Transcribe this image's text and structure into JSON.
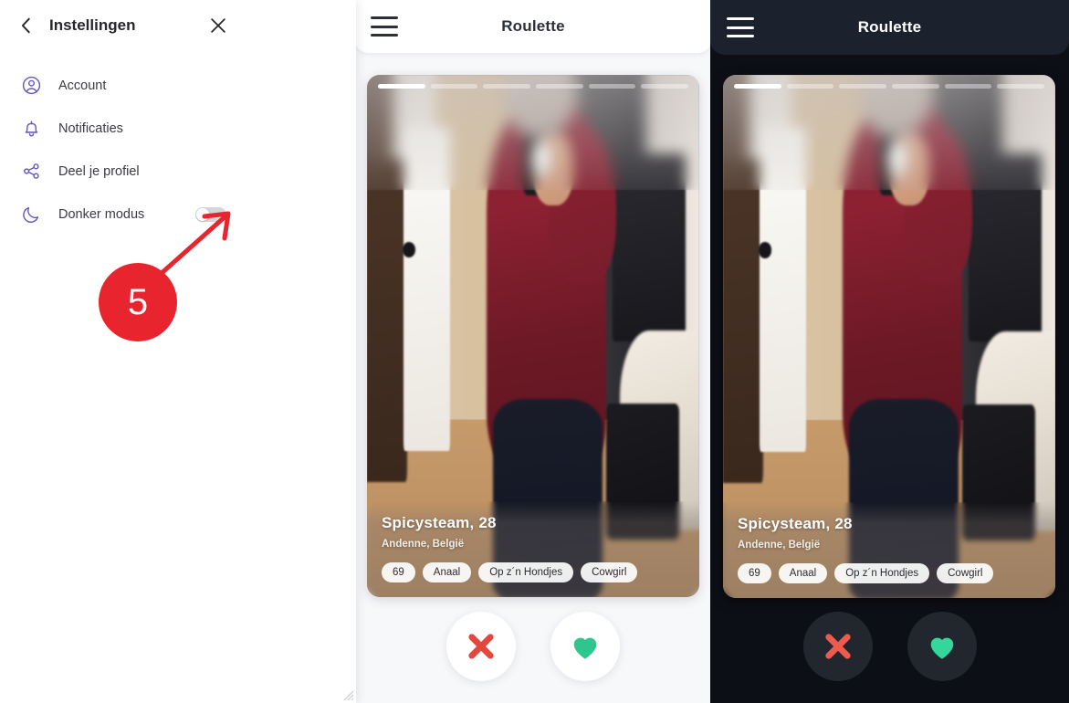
{
  "settings_panel": {
    "title": "Instellingen",
    "back_icon": "chevron-left-icon",
    "close_icon": "close-icon",
    "items": [
      {
        "label": "Account",
        "icon": "user-circle-icon",
        "type": "link"
      },
      {
        "label": "Notificaties",
        "icon": "bell-icon",
        "type": "link"
      },
      {
        "label": "Deel je profiel",
        "icon": "share-icon",
        "type": "link"
      },
      {
        "label": "Donker modus",
        "icon": "moon-icon",
        "type": "toggle",
        "toggle_on": false
      }
    ],
    "icon_color": "#6257c4",
    "text_color": "#3b3b41"
  },
  "annotation": {
    "step_number": "5",
    "badge_color": "#e8252e",
    "arrow_color": "#e8252e",
    "points_to": "donker-modus-toggle"
  },
  "phones": [
    {
      "id": "light",
      "theme": "light",
      "header": {
        "title": "Roulette",
        "menu_icon": "hamburger-menu-icon"
      },
      "background_color": "#f7f8fa",
      "header_color": "#ffffff",
      "card": {
        "stories": {
          "total": 6,
          "active_index": 0
        },
        "name": "Spicysteam, 28",
        "location": "Andenne, België",
        "tags": [
          "69",
          "Anaal",
          "Op z´n Hondjes",
          "Cowgirl"
        ]
      },
      "actions": [
        {
          "name": "dislike",
          "icon": "x-icon",
          "color": "#e1493f",
          "bg": "#ffffff"
        },
        {
          "name": "like",
          "icon": "heart-icon",
          "color": "#2ec58e",
          "bg": "#ffffff"
        }
      ]
    },
    {
      "id": "dark",
      "theme": "dark",
      "header": {
        "title": "Roulette",
        "menu_icon": "hamburger-menu-icon"
      },
      "background_color": "#0d0f16",
      "header_color": "#1b222e",
      "card": {
        "stories": {
          "total": 6,
          "active_index": 0
        },
        "name": "Spicysteam, 28",
        "location": "Andenne, België",
        "tags": [
          "69",
          "Anaal",
          "Op z´n Hondjes",
          "Cowgirl"
        ]
      },
      "actions": [
        {
          "name": "dislike",
          "icon": "x-icon",
          "color": "#ee5a4e",
          "bg": "#22262f"
        },
        {
          "name": "like",
          "icon": "heart-icon",
          "color": "#35d69c",
          "bg": "#22262f"
        }
      ]
    }
  ],
  "background_card": {
    "tags": [
      "Cowgirl"
    ]
  }
}
